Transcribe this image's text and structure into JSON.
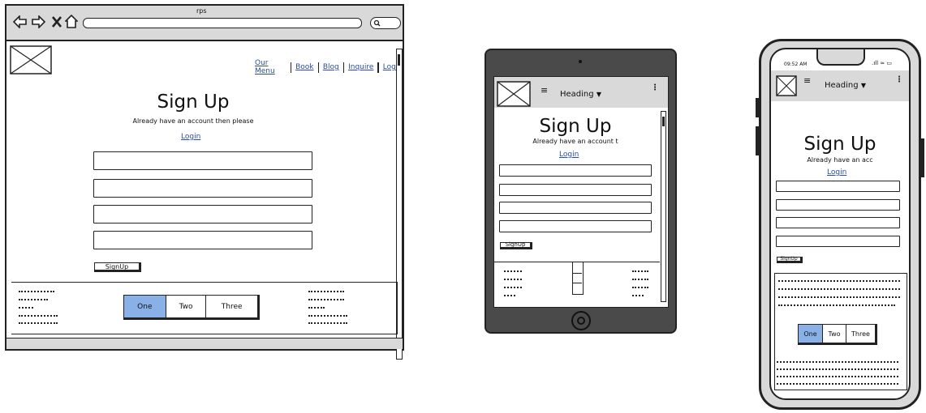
{
  "desktop": {
    "window_title": "rps",
    "nav_links": [
      "Our Menu",
      "Book",
      "Blog",
      "Inquire",
      "Login"
    ],
    "page_title": "Sign Up",
    "subtitle": "Already have an account then please",
    "login_link": "Login",
    "signup_button": "SignUp",
    "segments": [
      "One",
      "Two",
      "Three"
    ]
  },
  "tablet": {
    "header_heading": "Heading",
    "page_title": "Sign Up",
    "subtitle": "Already have an account t",
    "login_link": "Login",
    "signup_button": "SignUp"
  },
  "phone": {
    "status_time": "09:52 AM",
    "header_heading": "Heading",
    "page_title": "Sign Up",
    "subtitle": "Already have an acc",
    "login_link": "Login",
    "signup_button": "SignUp",
    "segments": [
      "One",
      "Two",
      "Three"
    ]
  },
  "colors": {
    "selected_segment": "#8ab0e8",
    "link": "#2a4d9c",
    "chrome": "#d9d9d9",
    "tablet_body": "#4a4a4a"
  }
}
